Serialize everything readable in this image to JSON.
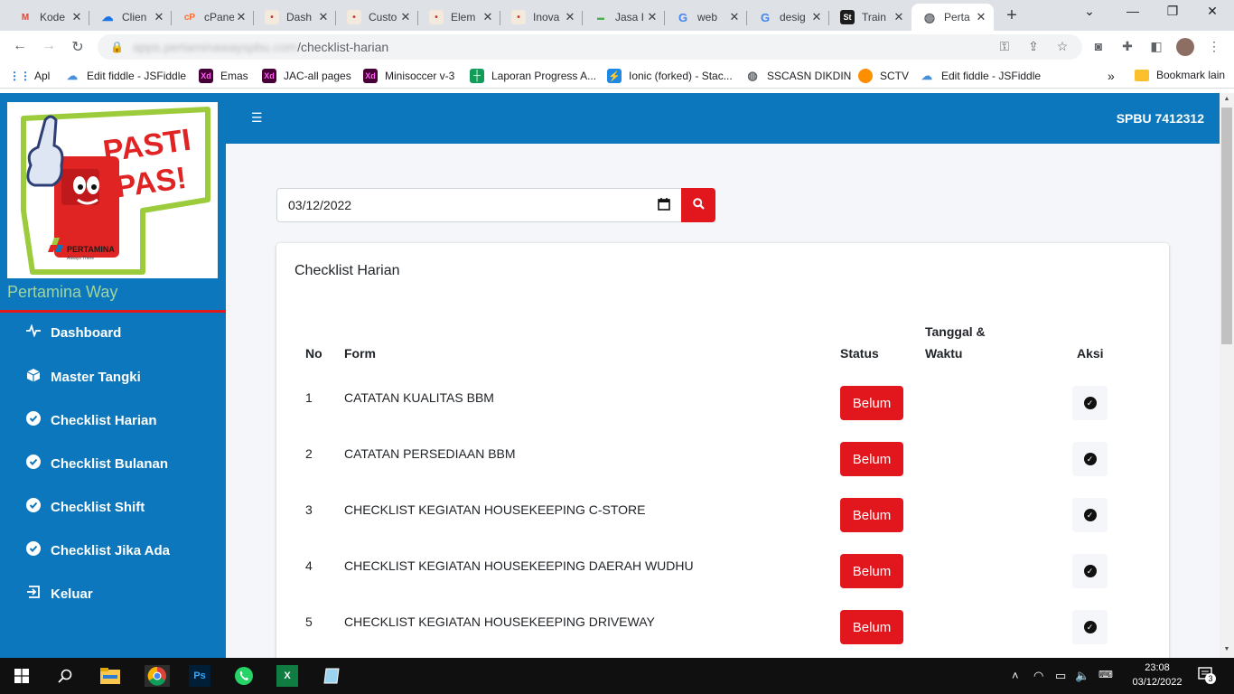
{
  "browser": {
    "tabs": [
      {
        "label": "Kode",
        "icon": "gmail-icon"
      },
      {
        "label": "Clien",
        "icon": "cloud-icon"
      },
      {
        "label": "cPane",
        "icon": "cpanel-icon"
      },
      {
        "label": "Dash",
        "icon": "site-icon"
      },
      {
        "label": "Custo",
        "icon": "site-icon"
      },
      {
        "label": "Elem",
        "icon": "site-icon"
      },
      {
        "label": "Inova",
        "icon": "site-icon"
      },
      {
        "label": "Jasa I",
        "icon": "site-icon"
      },
      {
        "label": "web",
        "icon": "google-icon"
      },
      {
        "label": "desig",
        "icon": "google-icon"
      },
      {
        "label": "Train",
        "icon": "st-icon"
      },
      {
        "label": "Perta",
        "icon": "globe-icon",
        "active": true
      }
    ],
    "url_path": "/checklist-harian",
    "url_host": "apps.pertaminawayspbu.com",
    "bookmarks": [
      {
        "label": "Apl"
      },
      {
        "label": "Edit fiddle - JSFiddle"
      },
      {
        "label": "Emas"
      },
      {
        "label": "JAC-all pages"
      },
      {
        "label": "Minisoccer v-3"
      },
      {
        "label": "Laporan Progress A..."
      },
      {
        "label": "Ionic (forked) - Stac..."
      },
      {
        "label": "SSCASN DIKDIN"
      },
      {
        "label": "SCTV"
      },
      {
        "label": "Edit fiddle - JSFiddle"
      }
    ],
    "bookmark_overflow": "»",
    "other_bookmarks": "Bookmark lain"
  },
  "sidebar": {
    "logo_text_1": "PASTI",
    "logo_text_2": "PAS!",
    "logo_company": "PERTAMINA",
    "logo_tagline": "Always There",
    "brand": "Pertamina Way",
    "items": [
      {
        "label": "Dashboard",
        "icon": "activity-icon"
      },
      {
        "label": "Master Tangki",
        "icon": "cube-icon"
      },
      {
        "label": "Checklist Harian",
        "icon": "check-circle-icon"
      },
      {
        "label": "Checklist Bulanan",
        "icon": "check-circle-icon"
      },
      {
        "label": "Checklist Shift",
        "icon": "check-circle-icon"
      },
      {
        "label": "Checklist Jika Ada",
        "icon": "check-circle-icon"
      },
      {
        "label": "Keluar",
        "icon": "logout-icon"
      }
    ]
  },
  "header": {
    "station": "SPBU 7412312"
  },
  "filter": {
    "date": "03/12/2022"
  },
  "card": {
    "title": "Checklist Harian",
    "columns": {
      "no": "No",
      "form": "Form",
      "status": "Status",
      "datetime_1": "Tanggal &",
      "datetime_2": "Waktu",
      "action": "Aksi"
    },
    "rows": [
      {
        "no": "1",
        "form": "CATATAN KUALITAS BBM",
        "status": "Belum",
        "datetime": ""
      },
      {
        "no": "2",
        "form": "CATATAN PERSEDIAAN BBM",
        "status": "Belum",
        "datetime": ""
      },
      {
        "no": "3",
        "form": "CHECKLIST KEGIATAN HOUSEKEEPING C-STORE",
        "status": "Belum",
        "datetime": ""
      },
      {
        "no": "4",
        "form": "CHECKLIST KEGIATAN HOUSEKEEPING DAERAH WUDHU",
        "status": "Belum",
        "datetime": ""
      },
      {
        "no": "5",
        "form": "CHECKLIST KEGIATAN HOUSEKEEPING DRIVEWAY",
        "status": "Belum",
        "datetime": ""
      }
    ]
  },
  "taskbar": {
    "time": "23:08",
    "date": "03/12/2022",
    "notifications": "3",
    "apps": [
      "file-explorer-icon",
      "chrome-icon",
      "photoshop-icon",
      "whatsapp-icon",
      "excel-icon",
      "notepad-icon"
    ]
  },
  "colors": {
    "primary": "#0d77bd",
    "danger": "#e2161d",
    "brand_text": "#9fd4a0"
  }
}
